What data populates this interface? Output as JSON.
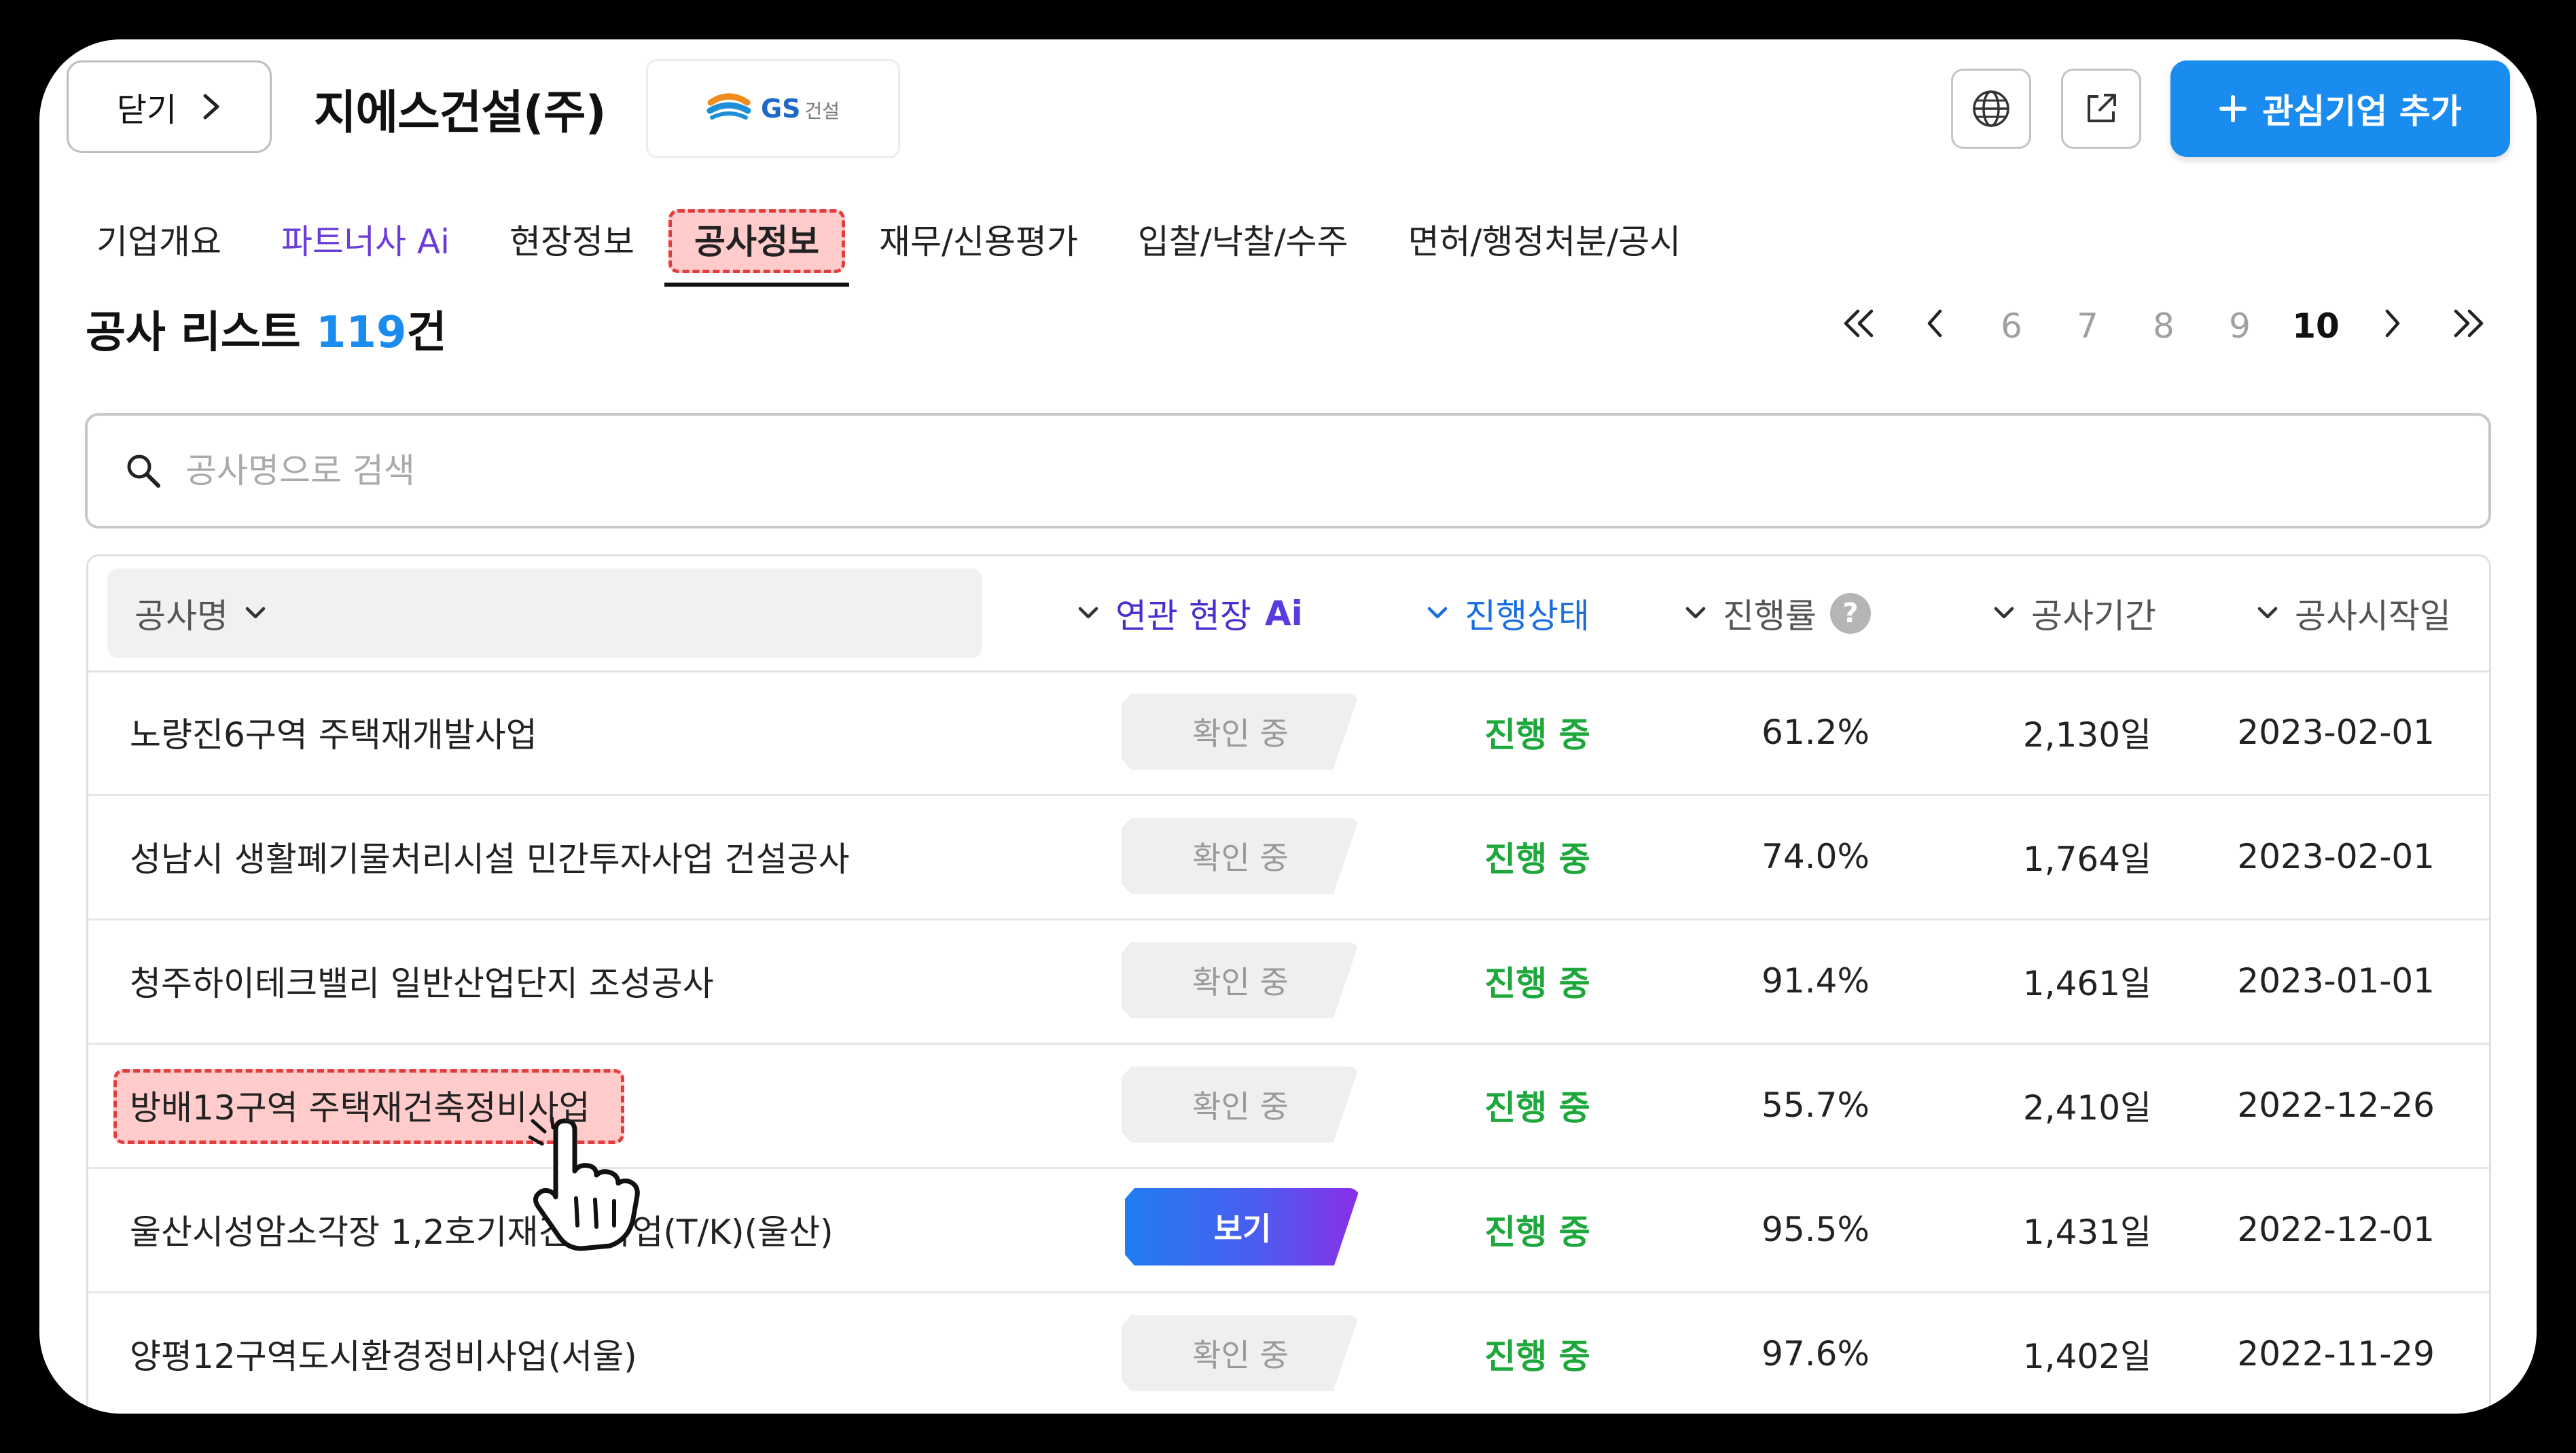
{
  "header": {
    "close_label": "닫기",
    "company_name": "지에스건설(주)",
    "logo": {
      "brand": "GS",
      "sub": "건설"
    },
    "icons": [
      "globe-icon",
      "external-link-icon"
    ],
    "add_button_label": "관심기업 추가"
  },
  "tabs": [
    {
      "label": "기업개요"
    },
    {
      "label": "파트너사 Ai"
    },
    {
      "label": "현장정보"
    },
    {
      "label": "공사정보"
    },
    {
      "label": "재무/신용평가"
    },
    {
      "label": "입찰/낙찰/수주"
    },
    {
      "label": "면허/행정처분/공시"
    }
  ],
  "active_tab": "공사정보",
  "list": {
    "title": "공사 리스트",
    "count": "119",
    "unit": "건"
  },
  "pagination": {
    "pages": [
      "6",
      "7",
      "8",
      "9",
      "10"
    ],
    "current": "10"
  },
  "search": {
    "placeholder": "공사명으로 검색",
    "value": ""
  },
  "table": {
    "columns": {
      "name": "공사명",
      "related": "연관 현장",
      "related_ai": "Ai",
      "status": "진행상태",
      "rate": "진행률",
      "period": "공사기간",
      "start": "공사시작일"
    },
    "rows": [
      {
        "name": "노량진6구역 주택재개발사업",
        "related": "확인 중",
        "status": "진행 중",
        "rate": "61.2%",
        "period": "2,130일",
        "start": "2023-02-01"
      },
      {
        "name": "성남시 생활폐기물처리시설 민간투자사업 건설공사",
        "related": "확인 중",
        "status": "진행 중",
        "rate": "74.0%",
        "period": "1,764일",
        "start": "2023-02-01"
      },
      {
        "name": "청주하이테크밸리 일반산업단지 조성공사",
        "related": "확인 중",
        "status": "진행 중",
        "rate": "91.4%",
        "period": "1,461일",
        "start": "2023-01-01"
      },
      {
        "name": "방배13구역 주택재건축정비사업",
        "related": "확인 중",
        "status": "진행 중",
        "rate": "55.7%",
        "period": "2,410일",
        "start": "2022-12-26"
      },
      {
        "name": "울산시성암소각장 1,2호기재건립사업(T/K)(울산)",
        "related": "보기",
        "status": "진행 중",
        "rate": "95.5%",
        "period": "1,431일",
        "start": "2022-12-01"
      },
      {
        "name": "양평12구역도시환경정비사업(서울)",
        "related": "확인 중",
        "status": "진행 중",
        "rate": "97.6%",
        "period": "1,402일",
        "start": "2022-11-29"
      }
    ]
  },
  "colors": {
    "accent": "#1a8cf0",
    "status_green": "#1ea83c",
    "ai_purple": "#5a3be0"
  }
}
